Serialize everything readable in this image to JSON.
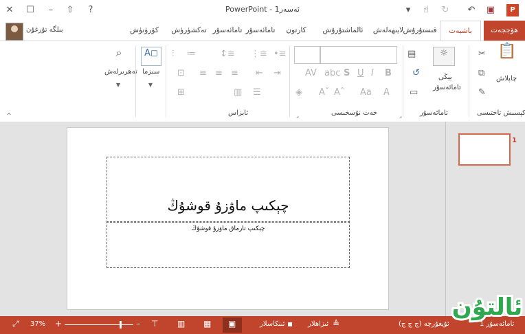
{
  "window": {
    "title": "PowerPoint - 1ئەسەر",
    "app_logo": "P"
  },
  "tabs": {
    "file": "ھۆججەت",
    "items": [
      "باشبەت",
      "قىستۇرۇش",
      "لايىھەلەش",
      "ئالماشتۇرۇش",
      "كارتون",
      "تامائەسۇر",
      "تەكشۈرۈش",
      "كۆرۈنۈش"
    ],
    "active_index": 0
  },
  "user": {
    "name": "بىلگە تۇرغۇن"
  },
  "ribbon": {
    "clipboard": {
      "paste": "چاپلاش",
      "label": "كېسىش تاختىسى"
    },
    "slides": {
      "new_slide_line1": "يېڭى",
      "new_slide_line2": "تامائەسۇر",
      "label": "تامائەسۇر"
    },
    "font": {
      "label": "خەت نۇسخىسى"
    },
    "paragraph": {
      "label": "ئابزاس"
    },
    "drawing": {
      "label": "سىزما"
    },
    "editing": {
      "label": "تەھرىرلەش"
    }
  },
  "slide": {
    "title": "چېكىپ ماۋزۇ قوشۇڭ",
    "subtitle": "چېكىپ تارماق ماۋزۇ قوشۇڭ"
  },
  "thumbnails": {
    "number": "1"
  },
  "statusbar": {
    "slide_info": "تامائەسۇر 1",
    "language": "ئۇيغۇرچە (ج ج ج)",
    "notes": "ئىزاھلار",
    "comments": "ئىنكاسلار",
    "zoom": "37%"
  },
  "logo": {
    "text": "ئالتۇن"
  },
  "colors": {
    "accent": "#c1442c",
    "logo_green": "#2fa84f"
  }
}
